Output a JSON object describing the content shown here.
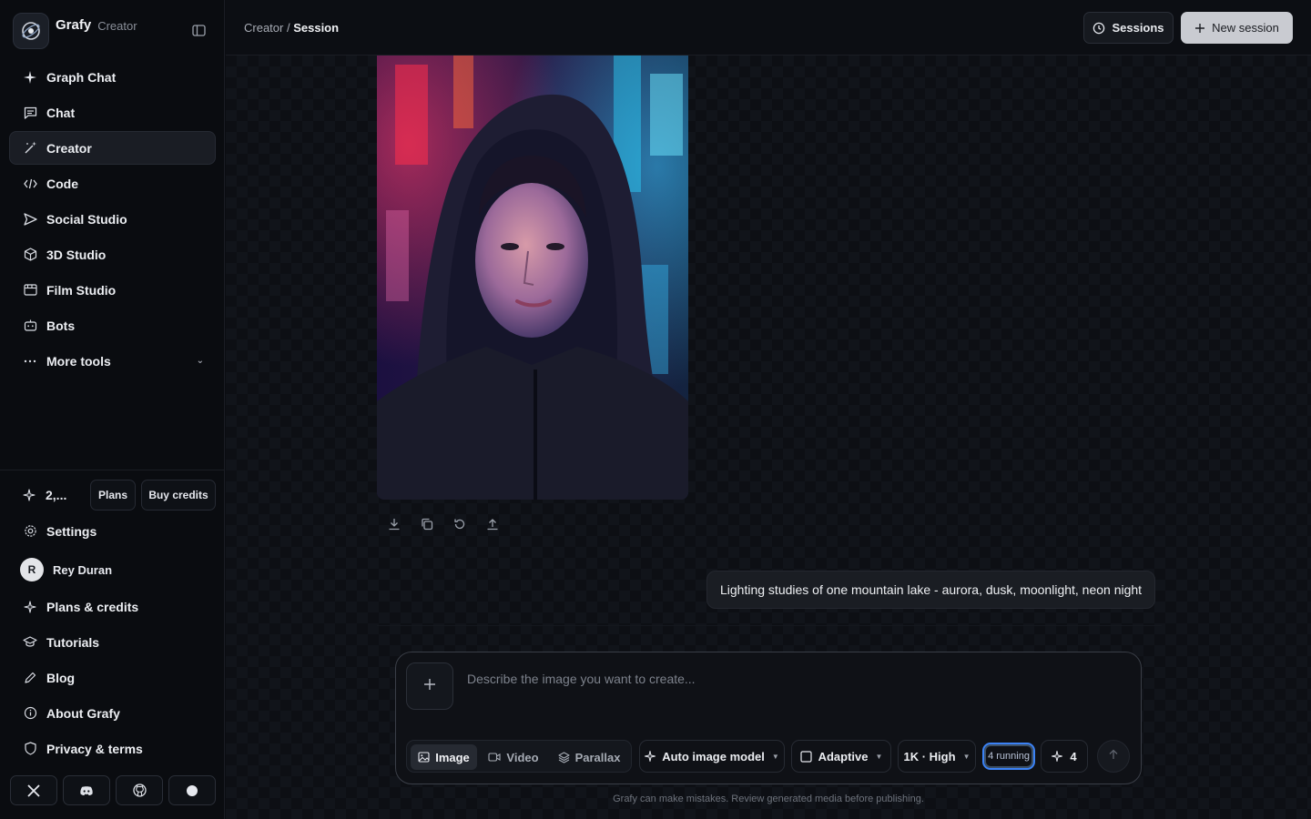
{
  "app": {
    "name": "Grafy",
    "section": "Creator"
  },
  "sidebar": {
    "items": [
      {
        "label": "Graph Chat",
        "icon": "sparkle-icon"
      },
      {
        "label": "Chat",
        "icon": "chat-icon"
      },
      {
        "label": "Creator",
        "icon": "magic-wand-icon",
        "active": true
      },
      {
        "label": "Code",
        "icon": "code-icon"
      },
      {
        "label": "Social Studio",
        "icon": "send-icon"
      },
      {
        "label": "3D Studio",
        "icon": "cube-icon"
      },
      {
        "label": "Film Studio",
        "icon": "film-icon"
      },
      {
        "label": "Bots",
        "icon": "bot-icon"
      },
      {
        "label": "More tools",
        "icon": "ellipsis-icon"
      }
    ],
    "credits": "2,...",
    "plans_label": "Plans",
    "buy_credits_label": "Buy credits",
    "settings_label": "Settings",
    "user": {
      "initial": "R",
      "name": "Rey Duran"
    },
    "bottom_items": [
      {
        "label": "Plans & credits",
        "icon": "sparkle-icon"
      },
      {
        "label": "Tutorials",
        "icon": "graduation-cap-icon"
      },
      {
        "label": "Blog",
        "icon": "pen-icon"
      },
      {
        "label": "About Grafy",
        "icon": "info-icon"
      },
      {
        "label": "Privacy & terms",
        "icon": "shield-icon"
      }
    ],
    "socials": [
      "x-icon",
      "discord-icon",
      "github-icon",
      "circle-icon"
    ]
  },
  "header": {
    "breadcrumb_parent": "Creator",
    "breadcrumb_sep": " / ",
    "breadcrumb_current": "Session",
    "sessions_label": "Sessions",
    "new_session_label": "New session"
  },
  "main": {
    "image_actions": [
      "download-icon",
      "copy-icon",
      "regenerate-icon",
      "share-icon"
    ],
    "prompt_text": "Lighting studies of one mountain lake - aurora, dusk, moonlight, neon night",
    "composer": {
      "placeholder": "Describe the image you want to create...",
      "modes": [
        "Image",
        "Video",
        "Parallax"
      ],
      "active_mode": "Image",
      "model": "Auto image model",
      "aspect": "Adaptive",
      "quality": "1K · High",
      "running": "4 running",
      "count": "4"
    },
    "disclaimer": "Grafy can make mistakes. Review generated media before publishing."
  },
  "colors": {
    "accent": "#3b82f6",
    "background": "#0b0d12",
    "sidebar": "#0a0c10"
  }
}
